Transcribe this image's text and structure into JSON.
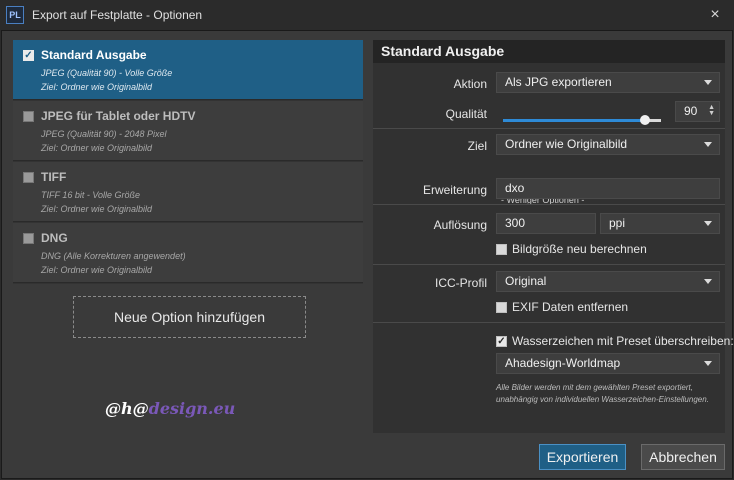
{
  "window": {
    "app_icon": "PL",
    "title": "Export auf Festplatte - Optionen",
    "close_icon": "×"
  },
  "presets": [
    {
      "title": "Standard Ausgabe",
      "line1": "JPEG (Qualität 90) - Volle Größe",
      "line2": "Ziel: Ordner wie Originalbild",
      "checked": true,
      "selected": true
    },
    {
      "title": "JPEG für Tablet oder HDTV",
      "line1": "JPEG (Qualität 90) - 2048 Pixel",
      "line2": "Ziel: Ordner wie Originalbild",
      "checked": false,
      "selected": false
    },
    {
      "title": "TIFF",
      "line1": "TIFF 16 bit - Volle Größe",
      "line2": "Ziel: Ordner wie Originalbild",
      "checked": false,
      "selected": false
    },
    {
      "title": "DNG",
      "line1": "DNG (Alle Korrekturen angewendet)",
      "line2": "Ziel: Ordner wie Originalbild",
      "checked": false,
      "selected": false
    }
  ],
  "add_option_label": "Neue Option hinzufügen",
  "watermark": {
    "part1": "@h@",
    "part2": "design.eu"
  },
  "panel": {
    "header": "Standard Ausgabe",
    "aktion_label": "Aktion",
    "aktion_value": "Als JPG exportieren",
    "qualitaet_label": "Qualität",
    "qualitaet_value": "90",
    "qualitaet_level": 0.9,
    "ziel_label": "Ziel",
    "ziel_value": "Ordner wie Originalbild",
    "fewer_options": "- Weniger Optionen -",
    "erweiterung_label": "Erweiterung",
    "erweiterung_value": "dxo",
    "aufloesung_label": "Auflösung",
    "aufloesung_value": "300",
    "aufloesung_unit": "ppi",
    "resize_label": "Bildgröße neu berechnen",
    "resize_checked": false,
    "icc_label": "ICC-Profil",
    "icc_value": "Original",
    "exif_label": "EXIF Daten entfernen",
    "exif_checked": false,
    "wasserzeichen_label": "Wasserzeichen mit Preset überschreiben:",
    "wasserzeichen_checked": true,
    "wasserzeichen_preset": "Ahadesign-Worldmap",
    "footnote": "Alle Bilder werden mit dem gewählten Preset exportiert, unabhängig von individuellen Wasserzeichen-Einstellungen."
  },
  "buttons": {
    "export": "Exportieren",
    "cancel": "Abbrechen"
  },
  "colors": {
    "accent": "#1f5f86",
    "slider": "#2e8ad6"
  }
}
